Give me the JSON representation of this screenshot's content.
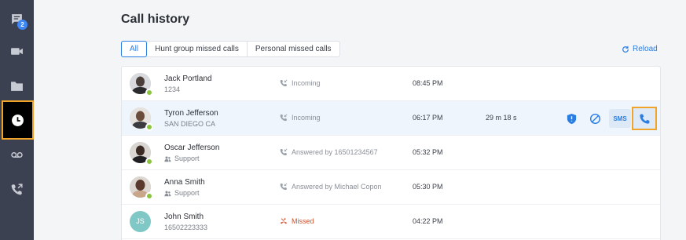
{
  "sidebar": {
    "items": [
      {
        "icon": "chat-icon",
        "badge": "2"
      },
      {
        "icon": "video-icon"
      },
      {
        "icon": "folder-icon"
      },
      {
        "icon": "clock-icon",
        "active": true
      },
      {
        "icon": "voicemail-icon"
      },
      {
        "icon": "phone-forward-icon"
      }
    ]
  },
  "page": {
    "title": "Call history",
    "reload_label": "Reload"
  },
  "tabs": [
    {
      "label": "All",
      "active": true
    },
    {
      "label": "Hunt group missed calls"
    },
    {
      "label": "Personal missed calls"
    }
  ],
  "calls": [
    {
      "name": "Jack Portland",
      "sub": "1234",
      "status": "Incoming",
      "time": "08:45 PM",
      "duration": ""
    },
    {
      "name": "Tyron Jefferson",
      "sub": "SAN DIEGO CA",
      "status": "Incoming",
      "time": "06:17 PM",
      "duration": "29 m 18 s"
    },
    {
      "name": "Oscar Jefferson",
      "sub": "Support",
      "status": "Answered by 16501234567",
      "time": "05:32 PM",
      "duration": ""
    },
    {
      "name": "Anna Smith",
      "sub": "Support",
      "status": "Answered by Michael Copon",
      "time": "05:30 PM",
      "duration": ""
    },
    {
      "name": "John Smith",
      "sub": "16502223333",
      "status": "Missed",
      "time": "04:22 PM",
      "duration": "",
      "initials": "JS"
    }
  ],
  "actions": {
    "sms_label": "SMS"
  },
  "colors": {
    "accent": "#2a7de1",
    "highlight_border": "#f0a52a",
    "presence": "#8ac53e",
    "missed": "#d0502c",
    "sidebar": "#3b4150"
  }
}
